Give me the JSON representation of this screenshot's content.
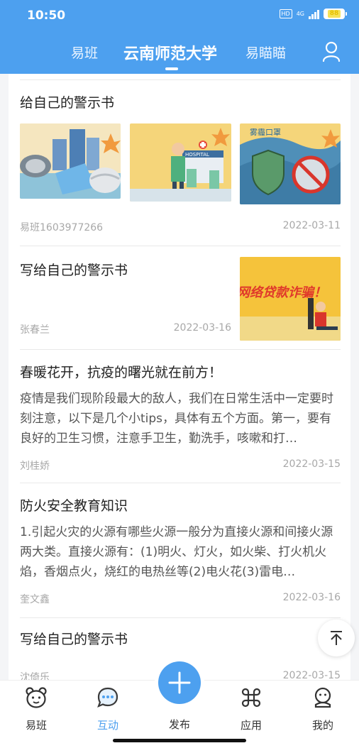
{
  "status_bar": {
    "time": "10:50",
    "hd": "HD",
    "network": "4G",
    "battery": "88"
  },
  "header": {
    "tabs": [
      {
        "label": "易班",
        "active": false
      },
      {
        "label": "云南师范大学",
        "active": true
      },
      {
        "label": "易瞄瞄",
        "active": false
      }
    ],
    "user_icon": "user-icon"
  },
  "feed": [
    {
      "title": "给自己的警示书",
      "author": "易班1603977266",
      "date": "2022-03-11",
      "images": [
        "masks-illustration",
        "hospital-illustration",
        "shield-virus-illustration"
      ]
    },
    {
      "title": "写给自己的警示书",
      "author": "张春兰",
      "date": "2022-03-16",
      "image_text": "网络贷款诈骗！"
    },
    {
      "title": "春暖花开，抗疫的曙光就在前方！",
      "excerpt": "疫情是我们现阶段最大的敌人，我们在日常生活中一定要时刻注意，以下是几个小tips，具体有五个方面。第一，要有良好的卫生习惯，注意手卫生，勤洗手，咳嗽和打…",
      "author": "刘桂娇",
      "date": "2022-03-15"
    },
    {
      "title": "防火安全教育知识",
      "excerpt": "1.引起火灾的火源有哪些火源一般分为直接火源和间接火源两大类。直接火源有：(1)明火、灯火，如火柴、打火机火焰，香烟点火，烧红的电热丝等(2)电火花(3)雷电…",
      "author": "奎文鑫",
      "date": "2022-03-16"
    },
    {
      "title": "写给自己的警示书",
      "author": "沈倚乐",
      "date": "2022-03-15"
    }
  ],
  "bottom_nav": [
    {
      "label": "易班",
      "icon": "bear-icon",
      "active": false
    },
    {
      "label": "互动",
      "icon": "chat-icon",
      "active": true
    },
    {
      "label": "发布",
      "icon": "plus-icon",
      "active": false
    },
    {
      "label": "应用",
      "icon": "apps-icon",
      "active": false
    },
    {
      "label": "我的",
      "icon": "profile-icon",
      "active": false
    }
  ],
  "colors": {
    "brand": "#4da0ef",
    "meta": "#a8a8a8"
  }
}
